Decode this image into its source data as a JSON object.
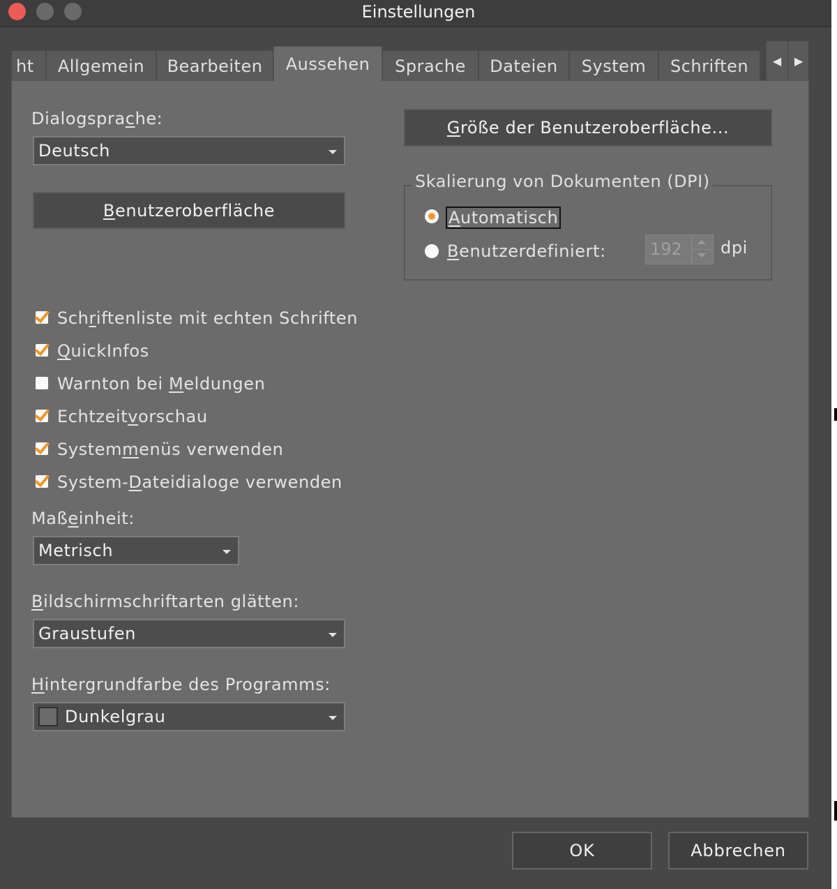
{
  "window": {
    "title": "Einstellungen"
  },
  "tabs": [
    {
      "label": "ht"
    },
    {
      "label": "Allgemein"
    },
    {
      "label": "Bearbeiten"
    },
    {
      "label": "Aussehen"
    },
    {
      "label": "Sprache"
    },
    {
      "label": "Dateien"
    },
    {
      "label": "System"
    },
    {
      "label": "Schriften"
    }
  ],
  "active_tab": "Aussehen",
  "tab_scroll": {
    "left_icon": "chevron-left-icon",
    "right_icon": "chevron-right-icon"
  },
  "dialog_language": {
    "label_pre": "Dialogspra",
    "label_key": "c",
    "label_post": "he:",
    "value": "Deutsch"
  },
  "ui_button": {
    "key": "B",
    "rest": "enutzeroberfläche"
  },
  "ui_size_button": {
    "key": "G",
    "rest": "röße der Benutzeroberfläche..."
  },
  "scaling": {
    "title": "Skalierung von Dokumenten (DPI)",
    "auto": {
      "key": "A",
      "rest": "utomatisch",
      "selected": true
    },
    "custom": {
      "key": "B",
      "rest": "enutzerdefiniert:",
      "selected": false
    },
    "dpi_value": "192",
    "dpi_unit": "dpi"
  },
  "checkboxes": [
    {
      "pre": "Sch",
      "key": "r",
      "post": "iftenliste mit echten Schriften",
      "checked": true
    },
    {
      "pre": "",
      "key": "Q",
      "post": "uickInfos",
      "checked": true
    },
    {
      "pre": "Warnton bei ",
      "key": "M",
      "post": "eldungen",
      "checked": false
    },
    {
      "pre": "Echtzeit",
      "key": "v",
      "post": "orschau",
      "checked": true
    },
    {
      "pre": "System",
      "key": "m",
      "post": "enüs verwenden",
      "checked": true
    },
    {
      "pre": "System-",
      "key": "D",
      "post": "ateidialoge verwenden",
      "checked": true
    }
  ],
  "unit": {
    "label_pre": "Maß",
    "label_key": "e",
    "label_post": "inheit:",
    "value": "Metrisch"
  },
  "smoothing": {
    "label_key": "B",
    "label_rest": "ildschirmschriftarten glätten:",
    "value": "Graustufen"
  },
  "background": {
    "label_key": "H",
    "label_rest": "intergrundfarbe des Programms:",
    "value": "Dunkelgrau",
    "swatch_color": "#6b6b6b"
  },
  "footer": {
    "ok": "OK",
    "cancel": "Abbrechen"
  },
  "colors": {
    "accent": "#f3962b",
    "close": "#ec5b55"
  }
}
